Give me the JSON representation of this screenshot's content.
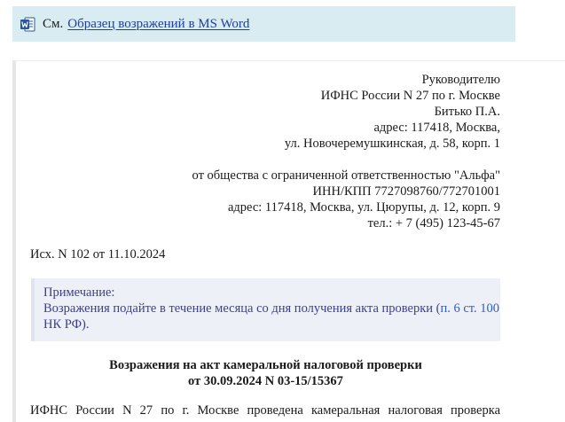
{
  "see_banner": {
    "icon": "ms-word-icon",
    "prefix": "См.",
    "link": "Образец возражений в MS Word"
  },
  "addressee": {
    "line1": "Руководителю",
    "line2": "ИФНС России N 27 по г. Москве",
    "line3": "Битько П.А.",
    "line4": "адрес: 117418, Москва,",
    "line5": "ул. Новочеремушкинская, д. 58, корп. 1"
  },
  "sender": {
    "line1": "от общества с ограниченной ответственностью \"Альфа\"",
    "line2": "ИНН/КПП 7727098760/772701001",
    "line3": "адрес: 117418, Москва, ул. Цюрупы, д. 12, корп. 9",
    "line4": "тел.: + 7 (495) 123-45-67"
  },
  "outgoing_ref": "Исх. N 102 от 11.10.2024",
  "note": {
    "label": "Примечание:",
    "text_before": "Возражения подайте в течение месяца со дня получения акта проверки (",
    "link_text": "п. 6 ст. 100",
    "text_after": " НК РФ)."
  },
  "title": {
    "line1": "Возражения на акт камеральной налоговой проверки",
    "line2": "от 30.09.2024 N 03-15/15367"
  },
  "body_first_line": "ИФНС России N 27 по г. Москве проведена камеральная налоговая проверка"
}
